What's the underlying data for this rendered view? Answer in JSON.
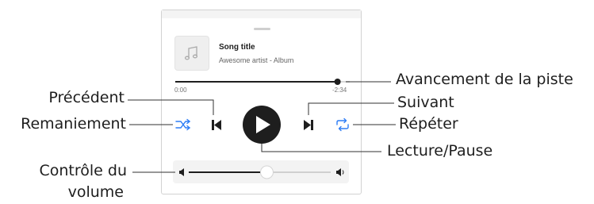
{
  "player": {
    "song_title": "Song title",
    "song_subtitle": "Awesome artist - Album",
    "elapsed": "0:00",
    "remaining": "-2:34",
    "track_progress": 0.93,
    "volume_level": 0.55,
    "icons": {
      "album": "music-note-icon",
      "shuffle": "shuffle-icon",
      "previous": "skip-previous-icon",
      "play": "play-icon",
      "next": "skip-next-icon",
      "repeat": "repeat-icon",
      "volume_low": "volume-low-icon",
      "volume_high": "volume-high-icon"
    }
  },
  "annotations": {
    "track_progress": "Avancement de la piste",
    "previous": "Précédent",
    "next": "Suivant",
    "shuffle": "Remaniement",
    "repeat": "Répéter",
    "play_pause": "Lecture/Pause",
    "volume_line1": "Contrôle du",
    "volume_line2": "volume"
  },
  "colors": {
    "accent": "#2d7df6",
    "dark": "#1e1e1e",
    "line": "#303030",
    "muted": "#d9d9d9"
  }
}
